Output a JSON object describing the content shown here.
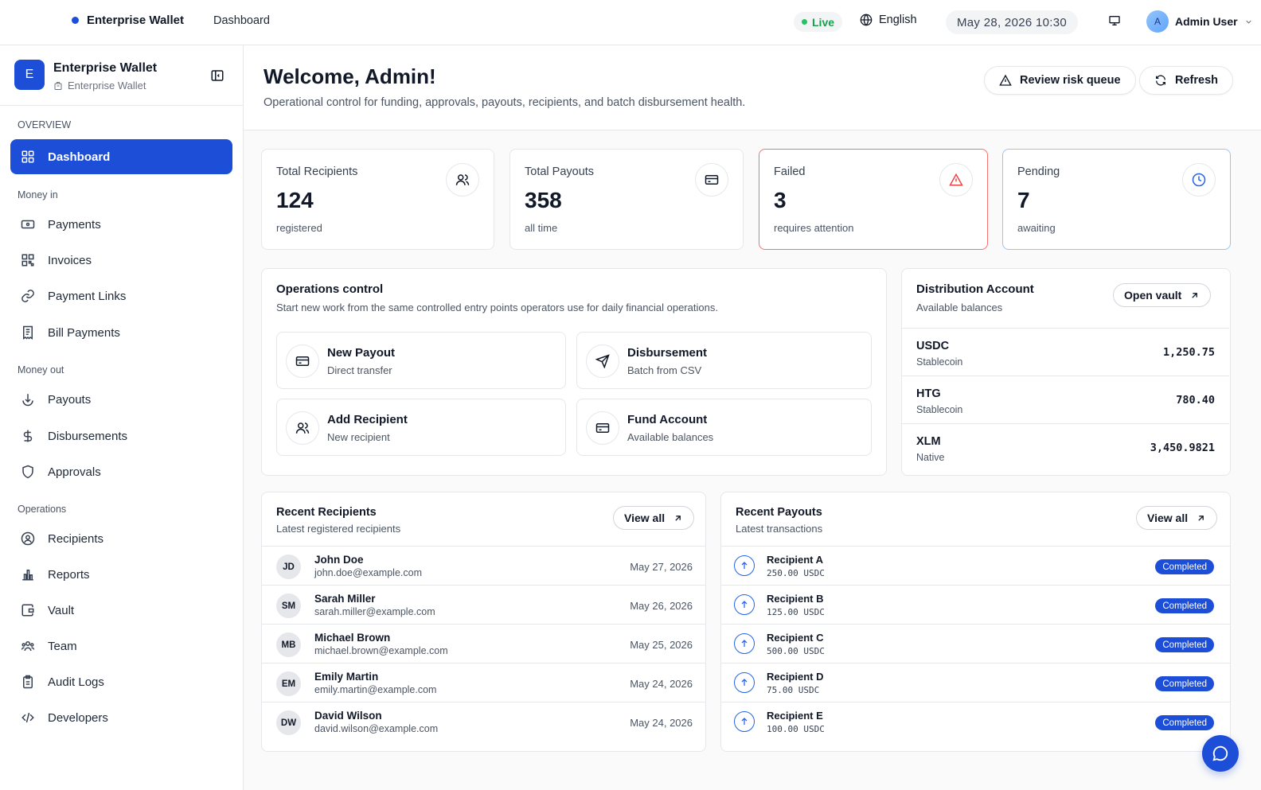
{
  "topbar": {
    "brand": "Enterprise Wallet",
    "breadcrumb": "Dashboard",
    "live_label": "Live",
    "language": "English",
    "datetime": "May 28, 2026 10:30",
    "user_initial": "A",
    "user_name": "Admin User"
  },
  "sidebar": {
    "logo_letter": "E",
    "title": "Enterprise Wallet",
    "subtitle": "Enterprise Wallet",
    "overview_label": "OVERVIEW",
    "dashboard_label": "Dashboard",
    "money_in_label": "Money in",
    "money_in": [
      {
        "label": "Payments",
        "icon": "money-icon"
      },
      {
        "label": "Invoices",
        "icon": "qr-grid-icon"
      },
      {
        "label": "Payment Links",
        "icon": "link-icon"
      },
      {
        "label": "Bill Payments",
        "icon": "receipt-icon"
      }
    ],
    "money_out_label": "Money out",
    "money_out": [
      {
        "label": "Payouts",
        "icon": "download-circle-icon"
      },
      {
        "label": "Disbursements",
        "icon": "dollar-icon"
      },
      {
        "label": "Approvals",
        "icon": "shield-icon"
      }
    ],
    "operations_label": "Operations",
    "operations": [
      {
        "label": "Recipients",
        "icon": "user-circle-icon"
      },
      {
        "label": "Reports",
        "icon": "bar-chart-icon"
      },
      {
        "label": "Vault",
        "icon": "wallet-icon"
      },
      {
        "label": "Team",
        "icon": "team-icon"
      },
      {
        "label": "Audit Logs",
        "icon": "clipboard-icon"
      },
      {
        "label": "Developers",
        "icon": "code-icon"
      }
    ]
  },
  "header": {
    "title": "Welcome, Admin!",
    "subtitle": "Operational control for funding, approvals, payouts, recipients, and batch disbursement health.",
    "review_label": "Review risk queue",
    "refresh_label": "Refresh"
  },
  "stats": {
    "recipients": {
      "label": "Total Recipients",
      "value": "124",
      "sub": "registered"
    },
    "payouts": {
      "label": "Total Payouts",
      "value": "358",
      "sub": "all time"
    },
    "failed": {
      "label": "Failed",
      "value": "3",
      "sub": "requires attention",
      "color": "#ef4444"
    },
    "pending": {
      "label": "Pending",
      "value": "7",
      "sub": "awaiting",
      "color": "#2563eb"
    }
  },
  "operations": {
    "title": "Operations control",
    "subtitle": "Start new work from the same controlled entry points operators use for daily financial operations.",
    "new_payout": {
      "title": "New Payout",
      "sub": "Direct transfer"
    },
    "disbursement": {
      "title": "Disbursement",
      "sub": "Batch from CSV"
    },
    "add_recipient": {
      "title": "Add Recipient",
      "sub": "New recipient"
    },
    "fund_account": {
      "title": "Fund Account",
      "sub": "Available balances"
    }
  },
  "distribution": {
    "title": "Distribution Account",
    "subtitle": "Available balances",
    "open_label": "Open vault",
    "balances": [
      {
        "asset": "USDC",
        "kind": "Stablecoin",
        "amount": "1,250.75"
      },
      {
        "asset": "HTG",
        "kind": "Stablecoin",
        "amount": "780.40"
      },
      {
        "asset": "XLM",
        "kind": "Native",
        "amount": "3,450.9821"
      }
    ]
  },
  "recent_recipients": {
    "title": "Recent Recipients",
    "subtitle": "Latest registered recipients",
    "view_all": "View all",
    "rows": [
      {
        "initials": "JD",
        "name": "John Doe",
        "email": "john.doe@example.com",
        "date": "May 27, 2026"
      },
      {
        "initials": "SM",
        "name": "Sarah Miller",
        "email": "sarah.miller@example.com",
        "date": "May 26, 2026"
      },
      {
        "initials": "MB",
        "name": "Michael Brown",
        "email": "michael.brown@example.com",
        "date": "May 25, 2026"
      },
      {
        "initials": "EM",
        "name": "Emily Martin",
        "email": "emily.martin@example.com",
        "date": "May 24, 2026"
      },
      {
        "initials": "DW",
        "name": "David Wilson",
        "email": "david.wilson@example.com",
        "date": "May 24, 2026"
      }
    ]
  },
  "recent_payouts": {
    "title": "Recent Payouts",
    "subtitle": "Latest transactions",
    "view_all": "View all",
    "rows": [
      {
        "name": "Recipient A",
        "amount": "250.00 USDC",
        "status": "Completed"
      },
      {
        "name": "Recipient B",
        "amount": "125.00 USDC",
        "status": "Completed"
      },
      {
        "name": "Recipient C",
        "amount": "500.00 USDC",
        "status": "Completed"
      },
      {
        "name": "Recipient D",
        "amount": "75.00 USDC",
        "status": "Completed"
      },
      {
        "name": "Recipient E",
        "amount": "100.00 USDC",
        "status": "Completed"
      }
    ]
  },
  "colors": {
    "accent": "#1d4ed8",
    "live": "#16a34a",
    "danger": "#ef4444"
  }
}
